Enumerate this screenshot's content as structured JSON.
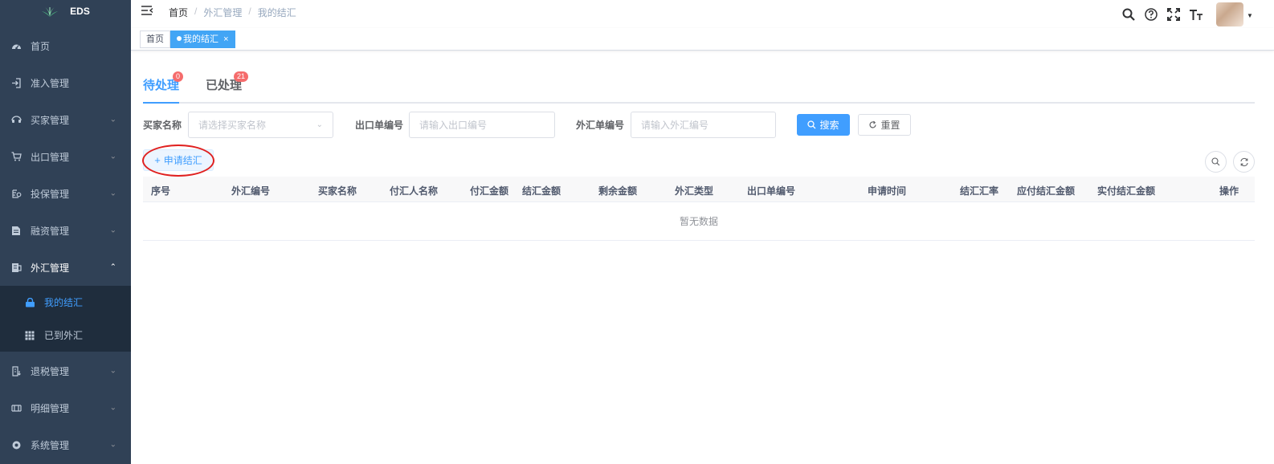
{
  "app": {
    "logo_text": "EDS"
  },
  "sidebar": {
    "items": [
      {
        "label": "首页",
        "icon": "dashboard-icon",
        "has_children": false
      },
      {
        "label": "准入管理",
        "icon": "login-icon",
        "has_children": false
      },
      {
        "label": "买家管理",
        "icon": "buyer-icon",
        "has_children": true
      },
      {
        "label": "出口管理",
        "icon": "cart-icon",
        "has_children": true
      },
      {
        "label": "投保管理",
        "icon": "insurance-icon",
        "has_children": true
      },
      {
        "label": "融资管理",
        "icon": "document-icon",
        "has_children": true
      },
      {
        "label": "外汇管理",
        "icon": "forex-icon",
        "has_children": true,
        "expanded": true
      },
      {
        "label": "退税管理",
        "icon": "tax-refund-icon",
        "has_children": true
      },
      {
        "label": "明细管理",
        "icon": "detail-icon",
        "has_children": true
      },
      {
        "label": "系统管理",
        "icon": "gear-icon",
        "has_children": true
      }
    ],
    "subitems": [
      {
        "label": "我的结汇",
        "icon": "lock-icon",
        "active": true
      },
      {
        "label": "已到外汇",
        "icon": "grid-icon",
        "active": false
      }
    ]
  },
  "header": {
    "breadcrumb": [
      "首页",
      "外汇管理",
      "我的结汇"
    ]
  },
  "tags": [
    {
      "label": "首页",
      "active": false
    },
    {
      "label": "我的结汇",
      "active": true
    }
  ],
  "tabs": [
    {
      "label": "待处理",
      "badge": "0",
      "active": true
    },
    {
      "label": "已处理",
      "badge": "21",
      "active": false
    }
  ],
  "filters": {
    "buyer_label": "买家名称",
    "buyer_placeholder": "请选择买家名称",
    "export_label": "出口单编号",
    "export_placeholder": "请输入出口编号",
    "forex_label": "外汇单编号",
    "forex_placeholder": "请输入外汇编号",
    "search_label": "搜索",
    "reset_label": "重置"
  },
  "actions": {
    "apply_label": "申请结汇"
  },
  "table": {
    "columns": [
      "序号",
      "外汇编号",
      "买家名称",
      "付汇人名称",
      "付汇金额",
      "结汇金额",
      "剩余金额",
      "外汇类型",
      "出口单编号",
      "申请时间",
      "结汇汇率",
      "应付结汇金额",
      "实付结汇金额",
      "操作"
    ],
    "empty_text": "暂无数据"
  },
  "colors": {
    "primary": "#409eff",
    "sidebar_bg": "#304156",
    "submenu_bg": "#1f2d3d",
    "badge": "#f56c6c",
    "annotation": "#e0201f"
  }
}
